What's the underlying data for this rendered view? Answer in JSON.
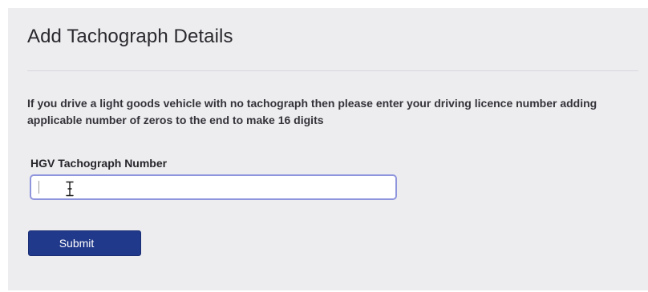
{
  "page": {
    "title": "Add Tachograph Details",
    "instruction": "If you drive a light goods vehicle with no tachograph then please enter your driving licence number adding applicable number of zeros to the end to make 16 digits"
  },
  "form": {
    "field_label": "HGV Tachograph Number",
    "field_value": "",
    "submit_label": "Submit"
  },
  "colors": {
    "panel_background": "#ededf0",
    "input_focus_border": "#8f95dc",
    "submit_background": "#21398a",
    "submit_text": "#ffffff"
  },
  "icons": {
    "cursor": "text-cursor-icon"
  }
}
